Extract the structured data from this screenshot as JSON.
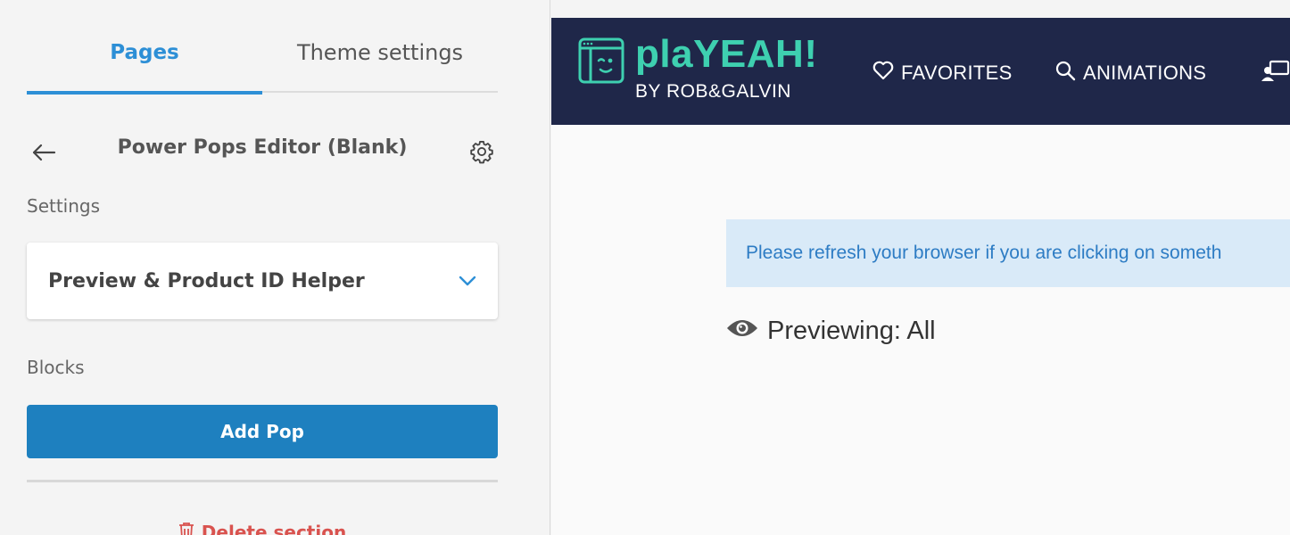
{
  "editor": {
    "tabs": [
      {
        "label": "Pages",
        "active": true
      },
      {
        "label": "Theme settings",
        "active": false
      }
    ],
    "section_title": "Power Pops Editor (Blank)",
    "settings_label": "Settings",
    "accordion_label": "Preview & Product ID Helper",
    "blocks_label": "Blocks",
    "add_button_label": "Add Pop",
    "delete_label": "Delete section",
    "accent_color": "#2d8fd6",
    "button_color": "#1e80bf",
    "danger_color": "#d9534f"
  },
  "preview": {
    "logo": {
      "title": "plaYEAH!",
      "subtitle": "BY ROB&GALVIN"
    },
    "nav": [
      {
        "label": "FAVORITES",
        "icon": "heart-icon"
      },
      {
        "label": "ANIMATIONS",
        "icon": "search-icon"
      },
      {
        "label": "",
        "icon": "user-monitor-icon"
      }
    ],
    "notice": "Please refresh your browser if you are clicking on someth",
    "previewing": "Previewing: All",
    "header_color": "#1f2749",
    "brand_color": "#3ed0b0"
  }
}
